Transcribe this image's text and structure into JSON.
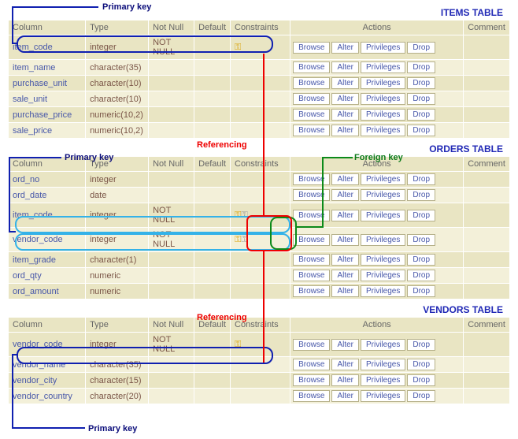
{
  "headers": {
    "column": "Column",
    "type": "Type",
    "notnull": "Not Null",
    "default": "Default",
    "constraints": "Constraints",
    "actions": "Actions",
    "comment": "Comment"
  },
  "action_labels": {
    "browse": "Browse",
    "alter": "Alter",
    "privileges": "Privileges",
    "drop": "Drop"
  },
  "labels": {
    "primary_key": "Primary key",
    "foreign_key": "Foreign key",
    "referencing": "Referencing"
  },
  "tables": {
    "items": {
      "title": "ITEMS TABLE",
      "rows": [
        {
          "column": "item_code",
          "type": "integer",
          "notnull": "NOT NULL",
          "pk": true
        },
        {
          "column": "item_name",
          "type": "character(35)"
        },
        {
          "column": "purchase_unit",
          "type": "character(10)"
        },
        {
          "column": "sale_unit",
          "type": "character(10)"
        },
        {
          "column": "purchase_price",
          "type": "numeric(10,2)"
        },
        {
          "column": "sale_price",
          "type": "numeric(10,2)"
        }
      ]
    },
    "orders": {
      "title": "ORDERS TABLE",
      "rows": [
        {
          "column": "ord_no",
          "type": "integer"
        },
        {
          "column": "ord_date",
          "type": "date"
        },
        {
          "column": "item_code",
          "type": "integer",
          "notnull": "NOT NULL",
          "pk": true,
          "fk": true
        },
        {
          "column": "vendor_code",
          "type": "integer",
          "notnull": "NOT NULL",
          "pk": true,
          "fk": true
        },
        {
          "column": "item_grade",
          "type": "character(1)"
        },
        {
          "column": "ord_qty",
          "type": "numeric"
        },
        {
          "column": "ord_amount",
          "type": "numeric"
        }
      ]
    },
    "vendors": {
      "title": "VENDORS TABLE",
      "rows": [
        {
          "column": "vendor_code",
          "type": "integer",
          "notnull": "NOT NULL",
          "pk": true
        },
        {
          "column": "vendor_name",
          "type": "character(35)"
        },
        {
          "column": "vendor_city",
          "type": "character(15)"
        },
        {
          "column": "vendor_country",
          "type": "character(20)"
        }
      ]
    }
  }
}
